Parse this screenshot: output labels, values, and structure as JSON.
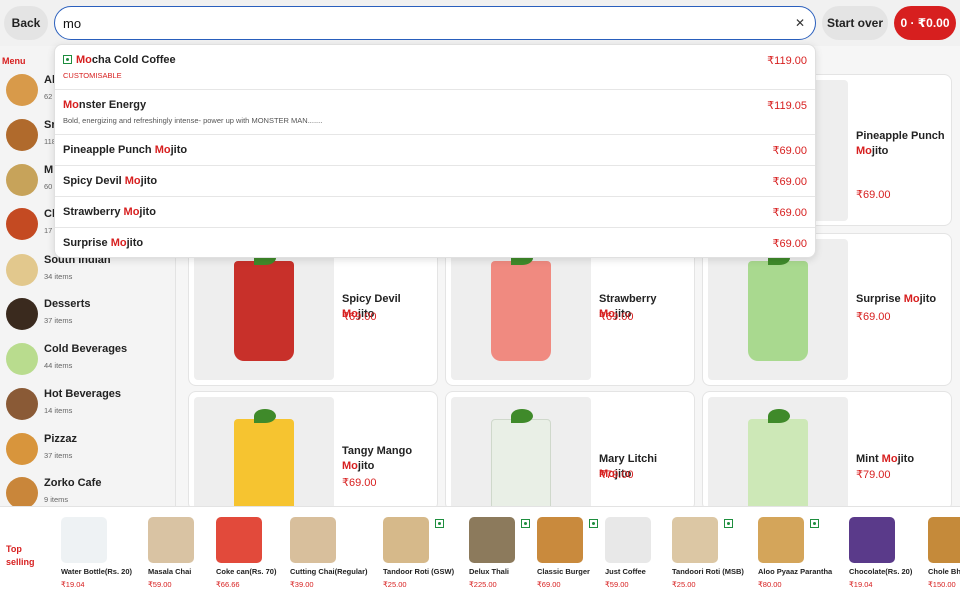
{
  "topbar": {
    "back_label": "Back",
    "search_value": "mo",
    "clear_icon": "close-icon",
    "start_over_label": "Start over",
    "cart_label": "0 · ₹0.00"
  },
  "sidebar": {
    "menu_label": "Menu",
    "categories": [
      {
        "name": "Al",
        "count": "62"
      },
      {
        "name": "Sr",
        "count": "118"
      },
      {
        "name": "M",
        "count": "60"
      },
      {
        "name": "Cl",
        "count": "17"
      },
      {
        "name": "South Indian",
        "count": "34 items"
      },
      {
        "name": "Desserts",
        "count": "37 items"
      },
      {
        "name": "Cold Beverages",
        "count": "44 items"
      },
      {
        "name": "Hot Beverages",
        "count": "14 items"
      },
      {
        "name": "Pizzaz",
        "count": "37 items"
      },
      {
        "name": "Zorko Cafe",
        "count": "9 items"
      }
    ]
  },
  "dropdown": [
    {
      "hl": "Mo",
      "rest": "cha Cold Coffee",
      "price": "₹119.00",
      "sub": "CUSTOMISABLE",
      "veg": true
    },
    {
      "hl": "Mo",
      "rest": "nster Energy",
      "price": "₹119.05",
      "sub": "Bold, energizing and refreshingly intense- power up with MONSTER MAN.......",
      "veg": false
    },
    {
      "pre": "Pineapple Punch ",
      "hl": "Mo",
      "rest": "jito",
      "price": "₹69.00"
    },
    {
      "pre": "Spicy Devil ",
      "hl": "Mo",
      "rest": "jito",
      "price": "₹69.00"
    },
    {
      "pre": "Strawberry ",
      "hl": "Mo",
      "rest": "jito",
      "price": "₹69.00"
    },
    {
      "pre": "Surprise ",
      "hl": "Mo",
      "rest": "jito",
      "price": "₹69.00"
    }
  ],
  "cards": [
    {
      "pre": "Pineapple Punch",
      "hl": "Mo",
      "rest": "jito",
      "price": "₹69.00",
      "color": "#f2f2f2"
    },
    {
      "pre": "Spicy Devil ",
      "hl": "Mo",
      "rest": "jito",
      "price": "₹69.00",
      "color": "#c8302a"
    },
    {
      "pre": "Strawberry ",
      "hl": "Mo",
      "rest": "jito",
      "price": "₹69.00",
      "color": "#f08a80"
    },
    {
      "pre": "Surprise ",
      "hl": "Mo",
      "rest": "jito",
      "price": "₹69.00",
      "color": "#a9d98f"
    },
    {
      "pre": "Tangy Mango",
      "hl": "Mo",
      "rest": "jito",
      "price": "₹69.00",
      "color": "#f6c430"
    },
    {
      "pre": "Mary Litchi ",
      "hl": "Mo",
      "rest": "jito",
      "price": "₹79.00",
      "color": "#e9efe6"
    },
    {
      "pre": "Mint ",
      "hl": "Mo",
      "rest": "jito",
      "price": "₹79.00",
      "color": "#cde8b7"
    }
  ],
  "top_selling": {
    "label": "Top selling",
    "items": [
      {
        "name": "Water Bottle(Rs. 20)",
        "price": "₹19.04",
        "veg": false
      },
      {
        "name": "Masala Chai",
        "price": "₹59.00",
        "veg": false
      },
      {
        "name": "Coke can(Rs. 70)",
        "price": "₹66.66",
        "veg": false
      },
      {
        "name": "Cutting Chai(Regular)",
        "price": "₹39.00",
        "veg": false
      },
      {
        "name": "Tandoor Roti (GSW)",
        "price": "₹25.00",
        "veg": true
      },
      {
        "name": "Delux Thali",
        "price": "₹225.00",
        "veg": true
      },
      {
        "name": "Classic Burger",
        "price": "₹69.00",
        "veg": true
      },
      {
        "name": "Just Coffee",
        "price": "₹59.00",
        "veg": false
      },
      {
        "name": "Tandoori Roti (MSB)",
        "price": "₹25.00",
        "veg": true
      },
      {
        "name": "Aloo Pyaaz Parantha",
        "price": "₹80.00",
        "veg": true
      },
      {
        "name": "Chocolate(Rs. 20)",
        "price": "₹19.04",
        "veg": false
      },
      {
        "name": "Chole Bhe",
        "price": "₹150.00",
        "veg": false
      }
    ]
  },
  "colors": {
    "accent": "#d71f1f",
    "veg": "#1e8e3e",
    "search_border": "#2a5fbd"
  }
}
